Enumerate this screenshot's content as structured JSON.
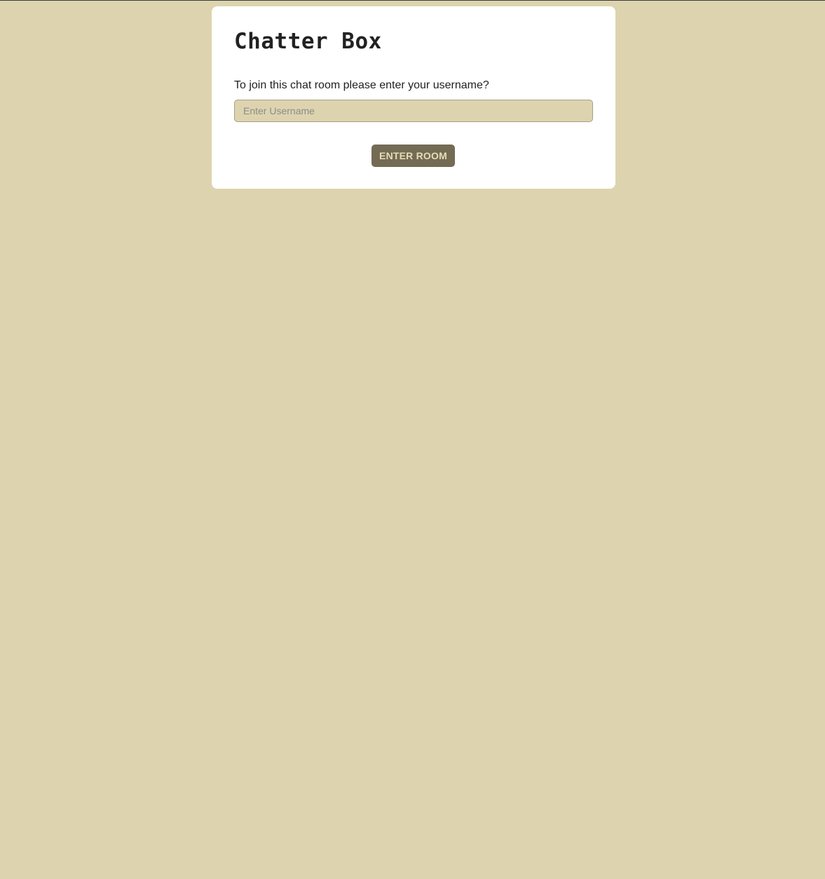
{
  "app": {
    "title": "Chatter Box"
  },
  "join_form": {
    "prompt": "To join this chat room please enter your username?",
    "username": {
      "value": "",
      "placeholder": "Enter Username"
    },
    "submit_label": "ENTER ROOM"
  },
  "colors": {
    "page_background": "#ddd4af",
    "card_background": "#ffffff",
    "input_background": "#ddd4af",
    "button_background": "#746b55",
    "button_text": "#e6dcb6"
  }
}
